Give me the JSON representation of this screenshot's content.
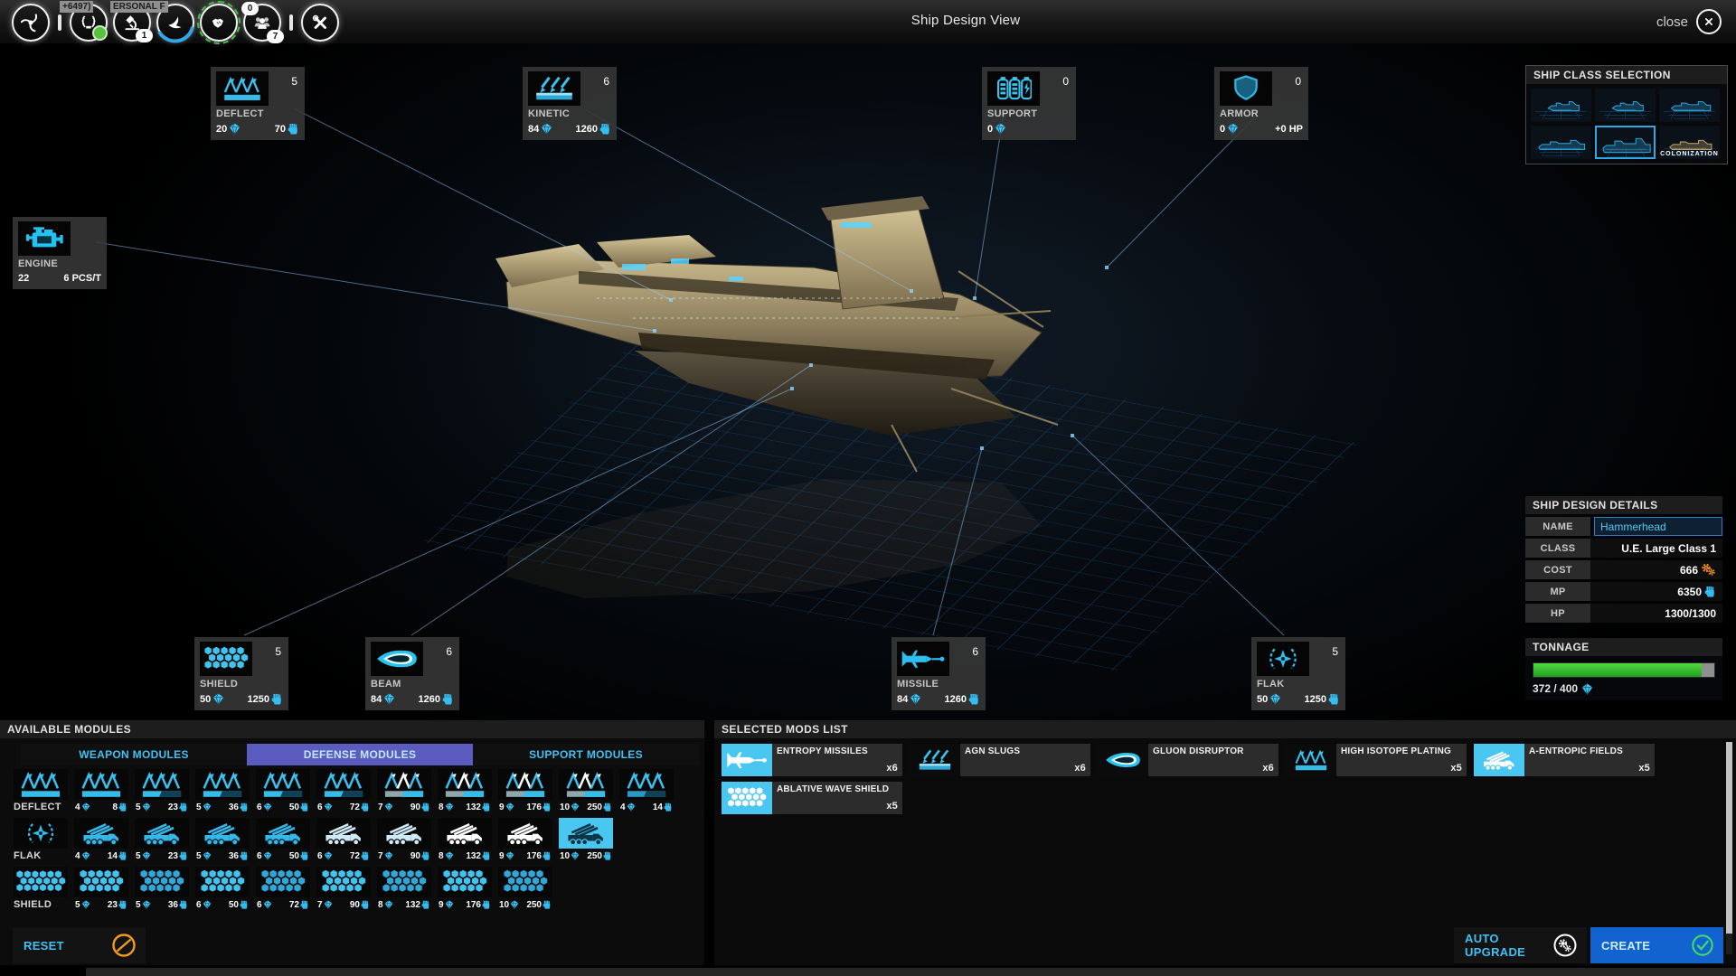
{
  "colors": {
    "accent": "#3ac1ef",
    "tab_active_bg": "#5b5bc0",
    "create_bg": "#1263cf",
    "tonnage_green": "#35c52f",
    "warn_orange": "#ee8a1e"
  },
  "topbar": {
    "title": "Ship Design View",
    "close_label": "close",
    "tooltip_left": "+6497)",
    "tooltip_right": "ERSONAL F",
    "science_badge": "1",
    "fleet_badge_top": "0",
    "fleet_badge_bottom": "7"
  },
  "ship_class_selection": {
    "title": "SHIP CLASS SELECTION",
    "thumbs": [
      {
        "label": "",
        "selected": false
      },
      {
        "label": "",
        "selected": false
      },
      {
        "label": "",
        "selected": false
      },
      {
        "label": "",
        "selected": false
      },
      {
        "label": "",
        "selected": true
      },
      {
        "label": "COLONIZATION",
        "selected": false
      }
    ]
  },
  "callouts": {
    "deflect": {
      "label": "DEFLECT",
      "count": "5",
      "cost": "20",
      "power": "70"
    },
    "kinetic": {
      "label": "KINETIC",
      "count": "6",
      "cost": "84",
      "power": "1260"
    },
    "support": {
      "label": "SUPPORT",
      "count": "0",
      "cost": "0"
    },
    "armor": {
      "label": "ARMOR",
      "count": "0",
      "cost": "0",
      "hp": "+0 HP"
    },
    "engine": {
      "label": "ENGINE",
      "speed": "22",
      "rate": "6 PCS/T"
    },
    "shield": {
      "label": "SHIELD",
      "count": "5",
      "cost": "50",
      "power": "1250"
    },
    "beam": {
      "label": "BEAM",
      "count": "6",
      "cost": "84",
      "power": "1260"
    },
    "missile": {
      "label": "MISSILE",
      "count": "6",
      "cost": "84",
      "power": "1260"
    },
    "flak": {
      "label": "FLAK",
      "count": "5",
      "cost": "50",
      "power": "1250"
    }
  },
  "design_details": {
    "title": "SHIP DESIGN DETAILS",
    "name_label": "NAME",
    "name_value": "Hammerhead",
    "class_label": "CLASS",
    "class_value": "U.E. Large Class 1",
    "cost_label": "COST",
    "cost_value": "666",
    "mp_label": "MP",
    "mp_value": "6350",
    "hp_label": "HP",
    "hp_value": "1300/1300"
  },
  "tonnage": {
    "title": "TONNAGE",
    "text": "372 / 400",
    "percent": 93
  },
  "available_modules": {
    "title": "AVAILABLE MODULES",
    "tabs": [
      {
        "label": "WEAPON MODULES",
        "active": false
      },
      {
        "label": "DEFENSE MODULES",
        "active": true
      },
      {
        "label": "SUPPORT MODULES",
        "active": false
      }
    ],
    "rows": [
      {
        "label": "DEFLECT",
        "icon": "deflect",
        "items": [
          {
            "cost": "4",
            "mp": "8"
          },
          {
            "cost": "5",
            "mp": "23"
          },
          {
            "cost": "5",
            "mp": "36"
          },
          {
            "cost": "6",
            "mp": "50"
          },
          {
            "cost": "6",
            "mp": "72"
          },
          {
            "cost": "7",
            "mp": "90"
          },
          {
            "cost": "8",
            "mp": "132"
          },
          {
            "cost": "9",
            "mp": "176"
          },
          {
            "cost": "10",
            "mp": "250"
          },
          {
            "cost": "4",
            "mp": "14"
          }
        ]
      },
      {
        "label": "FLAK",
        "icon": "flak",
        "items": [
          {
            "cost": "4",
            "mp": "14"
          },
          {
            "cost": "5",
            "mp": "23"
          },
          {
            "cost": "5",
            "mp": "36"
          },
          {
            "cost": "6",
            "mp": "50"
          },
          {
            "cost": "6",
            "mp": "72"
          },
          {
            "cost": "7",
            "mp": "90"
          },
          {
            "cost": "8",
            "mp": "132"
          },
          {
            "cost": "9",
            "mp": "176"
          },
          {
            "cost": "10",
            "mp": "250",
            "selected": true
          }
        ]
      },
      {
        "label": "SHIELD",
        "icon": "shield",
        "items": [
          {
            "cost": "5",
            "mp": "23"
          },
          {
            "cost": "5",
            "mp": "36"
          },
          {
            "cost": "6",
            "mp": "50"
          },
          {
            "cost": "6",
            "mp": "72"
          },
          {
            "cost": "7",
            "mp": "90"
          },
          {
            "cost": "8",
            "mp": "132"
          },
          {
            "cost": "9",
            "mp": "176"
          },
          {
            "cost": "10",
            "mp": "250"
          }
        ]
      }
    ]
  },
  "selected_mods": {
    "title": "SELECTED MODS LIST",
    "items": [
      {
        "name": "ENTROPY MISSILES",
        "qty": "x6",
        "icon": "missile",
        "highlight": true
      },
      {
        "name": "AGN SLUGS",
        "qty": "x6",
        "icon": "kinetic",
        "highlight": false
      },
      {
        "name": "GLUON DISRUPTOR",
        "qty": "x6",
        "icon": "beam",
        "highlight": false
      },
      {
        "name": "HIGH ISOTOPE PLATING",
        "qty": "x5",
        "icon": "deflect",
        "highlight": false
      },
      {
        "name": "A-ENTROPIC FIELDS",
        "qty": "x5",
        "icon": "truck",
        "highlight": true
      },
      {
        "name": "ABLATIVE WAVE SHIELD",
        "qty": "x5",
        "icon": "shield",
        "highlight": true
      }
    ]
  },
  "footer": {
    "reset": "RESET",
    "auto_upgrade": "AUTO UPGRADE",
    "create": "CREATE"
  }
}
